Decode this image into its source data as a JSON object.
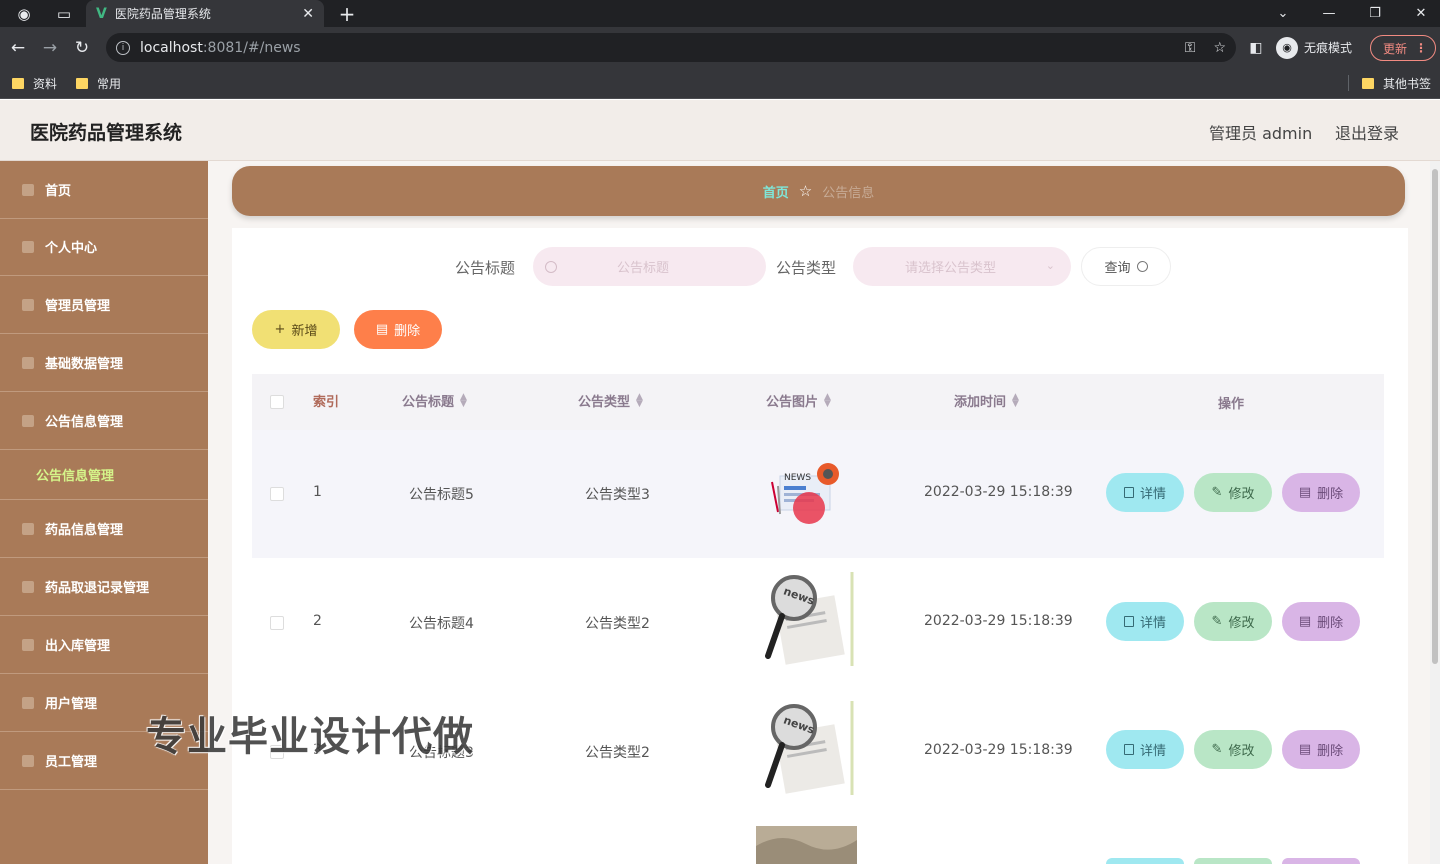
{
  "browser": {
    "tab_title": "医院药品管理系统",
    "url_host": "localhost",
    "url_path": ":8081/#/news",
    "incognito_label": "无痕模式",
    "update_label": "更新",
    "bookmarks": [
      "资料",
      "常用"
    ],
    "other_bookmarks": "其他书签"
  },
  "header": {
    "title": "医院药品管理系统",
    "user": "管理员 admin",
    "logout": "退出登录"
  },
  "sidebar": {
    "items": [
      {
        "label": "首页"
      },
      {
        "label": "个人中心"
      },
      {
        "label": "管理员管理"
      },
      {
        "label": "基础数据管理"
      },
      {
        "label": "公告信息管理"
      },
      {
        "label": "药品信息管理"
      },
      {
        "label": "药品取退记录管理"
      },
      {
        "label": "出入库管理"
      },
      {
        "label": "用户管理"
      },
      {
        "label": "员工管理"
      }
    ],
    "active_sub": "公告信息管理"
  },
  "breadcrumb": {
    "home": "首页",
    "current": "公告信息"
  },
  "search": {
    "title_label": "公告标题",
    "title_placeholder": "公告标题",
    "type_label": "公告类型",
    "type_placeholder": "请选择公告类型",
    "query_label": "查询"
  },
  "actions": {
    "add": "新增",
    "delete": "删除"
  },
  "table": {
    "columns": [
      "索引",
      "公告标题",
      "公告类型",
      "公告图片",
      "添加时间",
      "操作"
    ],
    "rows": [
      {
        "index": "1",
        "title": "公告标题5",
        "type": "公告类型3",
        "time": "2022-03-29 15:18:39"
      },
      {
        "index": "2",
        "title": "公告标题4",
        "type": "公告类型2",
        "time": "2022-03-29 15:18:39"
      },
      {
        "index": "3",
        "title": "公告标题3",
        "type": "公告类型2",
        "time": "2022-03-29 15:18:39"
      }
    ],
    "op_detail": "详情",
    "op_edit": "修改",
    "op_delete": "删除"
  },
  "watermark": "专业毕业设计代做",
  "colors": {
    "sidebar": "#a97a58",
    "header_bg": "#f2ede9",
    "add_btn": "#f1e074",
    "del_btn": "#fe7f4a",
    "detail_btn": "#9fe8f0",
    "edit_btn": "#b9e6c6",
    "delete_btn": "#d9b5e6"
  }
}
